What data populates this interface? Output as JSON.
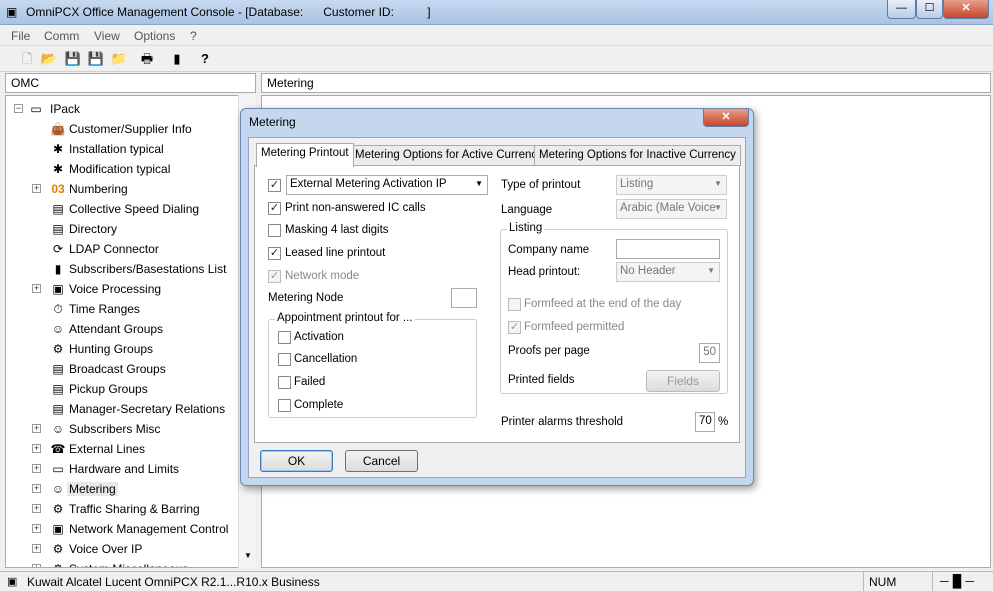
{
  "window": {
    "title": "OmniPCX Office Management Console - [Database:      Customer ID:          ]",
    "min_label": "—",
    "max_label": "☐",
    "close_label": "✕"
  },
  "menu": [
    "File",
    "Comm",
    "View",
    "Options",
    "?"
  ],
  "toolbar_icons": [
    "new-icon",
    "open-icon",
    "save-disabled-icon",
    "save-icon",
    "folder-icon",
    "print-icon",
    "exit-icon",
    "help-icon"
  ],
  "left_header": "OMC",
  "right_header": "Metering",
  "tree": {
    "root": "IPack",
    "items": [
      {
        "label": "Customer/Supplier Info",
        "expand": ""
      },
      {
        "label": "Installation typical",
        "expand": ""
      },
      {
        "label": "Modification typical",
        "expand": ""
      },
      {
        "label": "Numbering",
        "expand": "+"
      },
      {
        "label": "Collective Speed Dialing",
        "expand": ""
      },
      {
        "label": "Directory",
        "expand": ""
      },
      {
        "label": "LDAP Connector",
        "expand": ""
      },
      {
        "label": "Subscribers/Basestations List",
        "expand": ""
      },
      {
        "label": "Voice Processing",
        "expand": "+"
      },
      {
        "label": "Time Ranges",
        "expand": ""
      },
      {
        "label": "Attendant Groups",
        "expand": ""
      },
      {
        "label": "Hunting Groups",
        "expand": ""
      },
      {
        "label": "Broadcast Groups",
        "expand": ""
      },
      {
        "label": "Pickup Groups",
        "expand": ""
      },
      {
        "label": "Manager-Secretary Relations",
        "expand": ""
      },
      {
        "label": "Subscribers Misc",
        "expand": "+"
      },
      {
        "label": "External Lines",
        "expand": "+"
      },
      {
        "label": "Hardware and Limits",
        "expand": "+"
      },
      {
        "label": "Metering",
        "expand": "+"
      },
      {
        "label": "Traffic Sharing & Barring",
        "expand": "+"
      },
      {
        "label": "Network Management Control",
        "expand": "+"
      },
      {
        "label": "Voice Over IP",
        "expand": "+"
      },
      {
        "label": "System Miscellaneous",
        "expand": "+"
      }
    ]
  },
  "dialog": {
    "title": "Metering",
    "close_label": "✕",
    "tabs": [
      "Metering Printout",
      "Metering Options for Active Currency",
      "Metering Options for Inactive Currency"
    ],
    "external_metering": "External Metering  Activation IP",
    "print_non_answered": "Print non-answered IC calls",
    "masking": "Masking 4 last digits",
    "leased_line": "Leased line printout",
    "network_mode": "Network mode",
    "metering_node_label": "Metering Node",
    "metering_node_value": "",
    "appointment_group": "Appointment printout for ...",
    "activation": "Activation",
    "cancellation": "Cancellation",
    "failed": "Failed",
    "complete": "Complete",
    "type_of_printout_label": "Type of printout",
    "type_of_printout_value": "Listing",
    "language_label": "Language",
    "language_value": "Arabic (Male Voice",
    "listing_group": "Listing",
    "company_name_label": "Company name",
    "company_name_value": "",
    "head_printout_label": "Head printout:",
    "head_printout_value": "No Header",
    "formfeed_end_day": "Formfeed at the end of the day",
    "formfeed_permitted": "Formfeed permitted",
    "proofs_label": "Proofs per page",
    "proofs_value": "50",
    "printed_fields_label": "Printed fields",
    "fields_button": "Fields",
    "alarms_label": "Printer alarms threshold",
    "alarms_value": "70",
    "alarms_unit": "%",
    "ok": "OK",
    "cancel": "Cancel",
    "checked_mark": "✓"
  },
  "status": {
    "left": "Kuwait Alcatel Lucent OmniPCX R2.1...R10.x Business",
    "num": "NUM"
  }
}
